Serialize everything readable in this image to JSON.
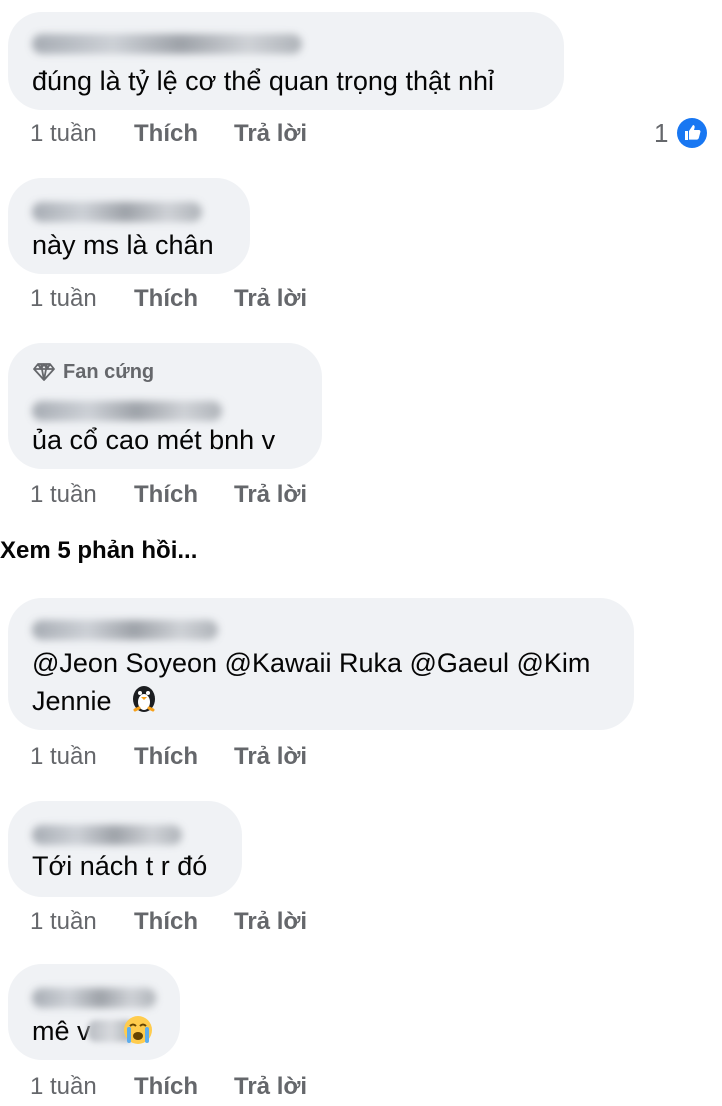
{
  "comments": [
    {
      "text": "đúng là tỷ lệ cơ thể quan trọng thật nhỉ",
      "time": "1 tuần",
      "like": "Thích",
      "reply": "Trả lời",
      "reaction_count": "1"
    },
    {
      "text": "này ms là chân",
      "time": "1 tuần",
      "like": "Thích",
      "reply": "Trả lời"
    },
    {
      "badge": "Fan cứng",
      "text": "ủa cổ cao mét bnh v",
      "time": "1 tuần",
      "like": "Thích",
      "reply": "Trả lời"
    },
    {
      "line1": "@Jeon Soyeon @Kawaii Ruka @Gaeul @Kim",
      "line2": "Jennie",
      "time": "1 tuần",
      "like": "Thích",
      "reply": "Trả lời"
    },
    {
      "text": "Tới nách t r đó",
      "time": "1 tuần",
      "like": "Thích",
      "reply": "Trả lời"
    },
    {
      "text": "mê v",
      "time": "1 tuần",
      "like": "Thích",
      "reply": "Trả lời"
    }
  ],
  "view_replies": "Xem 5 phản hồi...",
  "icons": {
    "reaction": "like-reaction-icon",
    "badge": "diamond-icon",
    "penguin": "penguin-emoji",
    "crying": "crying-face-emoji"
  },
  "colors": {
    "bubble": "#f0f2f5",
    "meta": "#65676b",
    "like_blue": "#1877f2"
  }
}
